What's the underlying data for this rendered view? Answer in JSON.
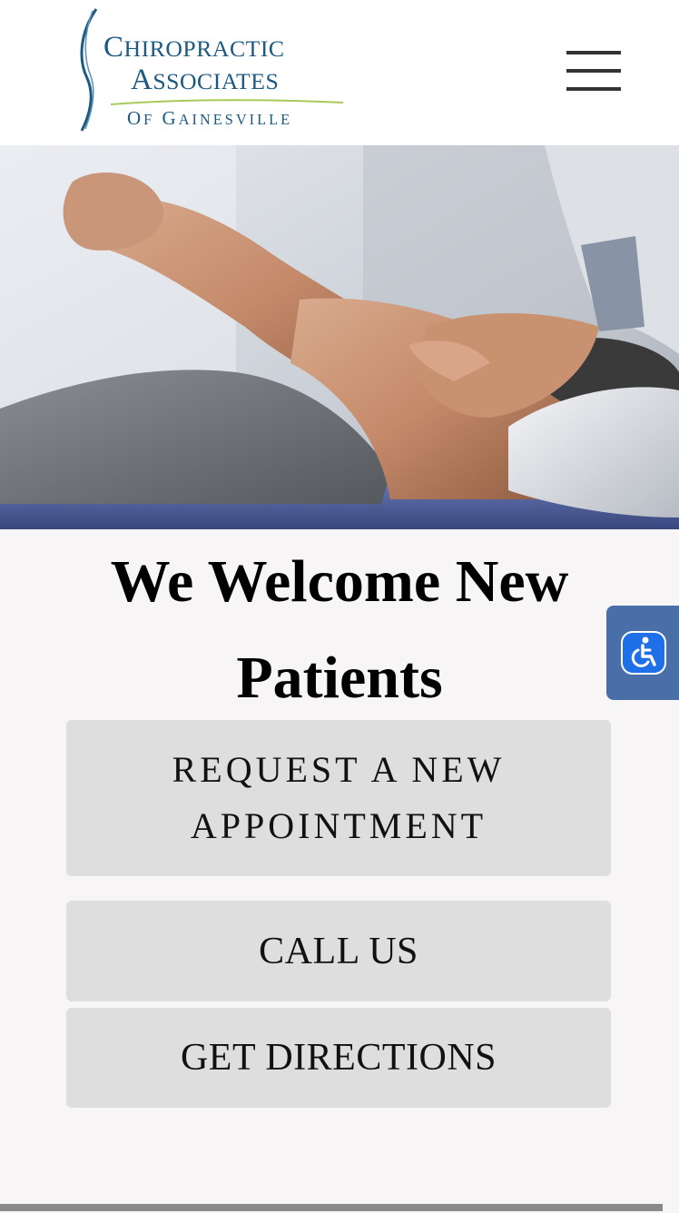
{
  "header": {
    "logo": {
      "line1": "Chiropractic",
      "line2": "Associates",
      "line3": "of Gainesville"
    },
    "menu_icon": "hamburger-menu-icon"
  },
  "hero": {
    "image": "chiropractor-adjusting-patient-shoulder-photo"
  },
  "main": {
    "heading": "We Welcome New Patients",
    "buttons": {
      "appointment": "REQUEST A NEW APPOINTMENT",
      "call": "CALL US",
      "directions": "GET DIRECTIONS"
    }
  },
  "accessibility": {
    "icon": "wheelchair-accessibility-icon"
  },
  "colors": {
    "brand_blue": "#1d5a82",
    "accent_green": "#a9c95a",
    "button_gray": "#dedede",
    "accessibility_blue": "#4a6ea7"
  }
}
